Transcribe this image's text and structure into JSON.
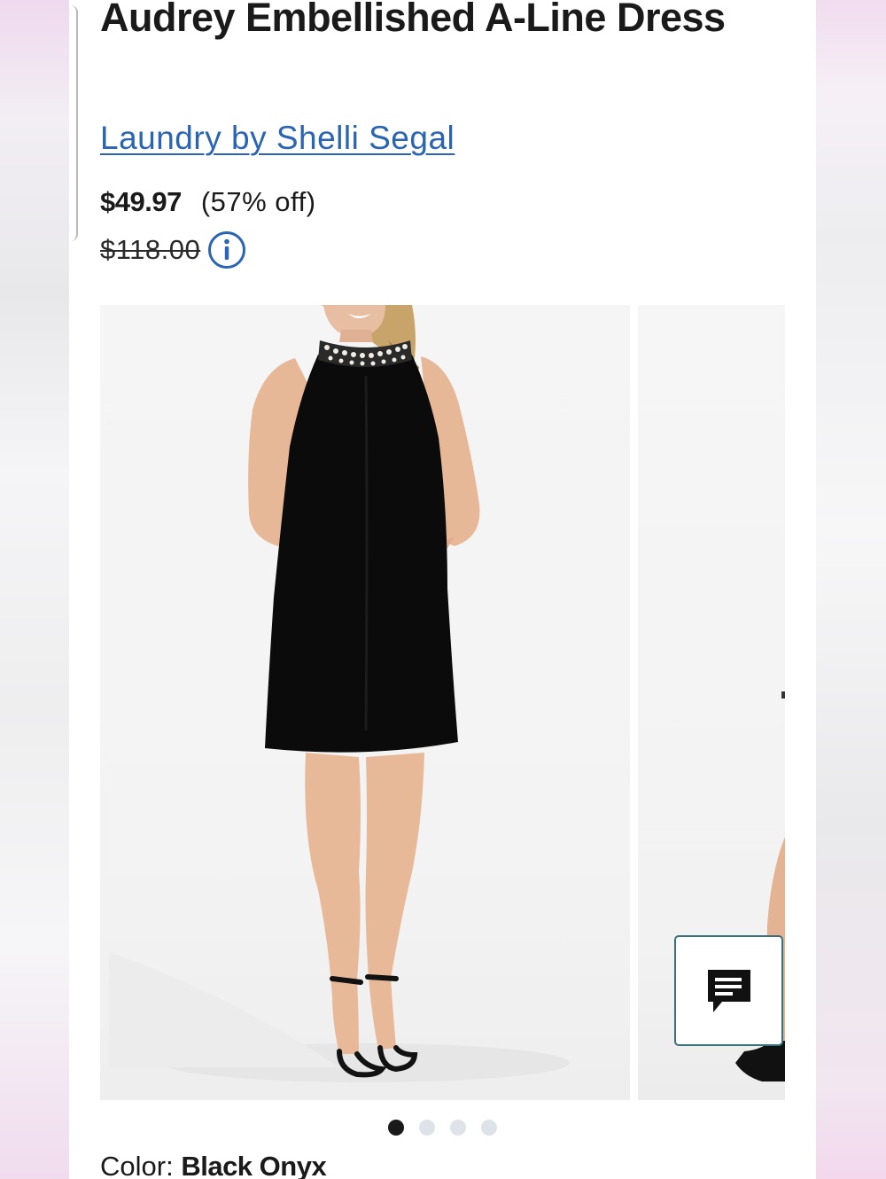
{
  "product": {
    "title": "Audrey Embellished A-Line Dress",
    "brand": "Laundry by Shelli Segal",
    "sale_price": "$49.97",
    "discount": "(57% off)",
    "original_price": "$118.00"
  },
  "gallery": {
    "dots": 4,
    "active_index": 0
  },
  "color": {
    "label": "Color:",
    "value": "Black Onyx"
  },
  "icons": {
    "info": "info-icon",
    "chat": "chat-icon"
  },
  "colors": {
    "accent": "#2a64b4",
    "text": "#1a1a1a",
    "chat_border": "#3a6f7c"
  }
}
